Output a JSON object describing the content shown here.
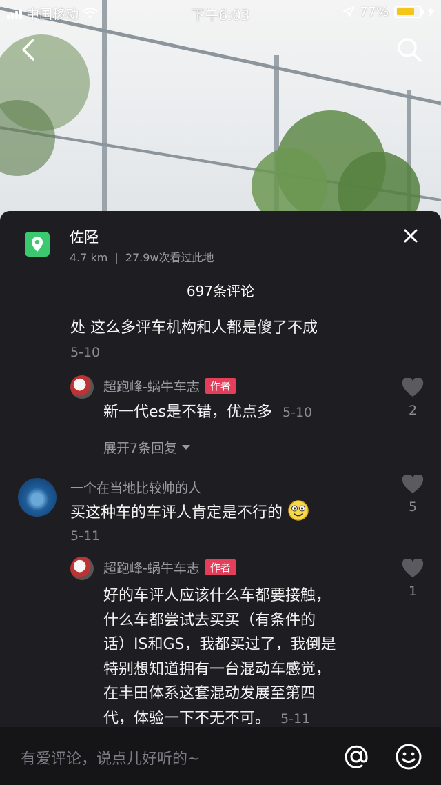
{
  "status_bar": {
    "carrier": "中国移动",
    "time": "下午6:03",
    "battery": "77%",
    "battery_level": 0.77
  },
  "location": {
    "name": "佐陉",
    "distance": "4.7 km",
    "separator": "|",
    "views": "27.9w次看过此地"
  },
  "comments_header": {
    "count_label": "697条评论"
  },
  "comments": {
    "c0": {
      "text": "处 这么多评车机构和人都是傻了不成",
      "date": "5-10"
    },
    "r1": {
      "username": "超跑峰-蜗牛车志",
      "tag": "作者",
      "text": "新一代es是不错，优点多",
      "date": "5-10",
      "likes": "2"
    },
    "expand": {
      "label": "展开7条回复"
    },
    "c2": {
      "username": "一个在当地比较帅的人",
      "text": "买这种车的车评人肯定是不行的",
      "date": "5-11",
      "likes": "5"
    },
    "r2": {
      "username": "超跑峰-蜗牛车志",
      "tag": "作者",
      "lines": [
        "好的车评人应该什么车都要接触，",
        "什么车都尝试去买买（有条件的",
        "话）IS和GS，我都买过了，我倒是",
        "特别想知道拥有一台混动车感觉，",
        "在丰田体系这套混动发展至第四",
        "代，体验一下不无不可。"
      ],
      "date": "5-11",
      "likes": "1"
    }
  },
  "input": {
    "placeholder": "有爱评论，说点儿好听的~"
  },
  "colors": {
    "sheet_bg": "#1e1e22",
    "accent_red": "#e43f5a",
    "location_green": "#3cc86f",
    "battery_yellow": "#f5c518"
  }
}
